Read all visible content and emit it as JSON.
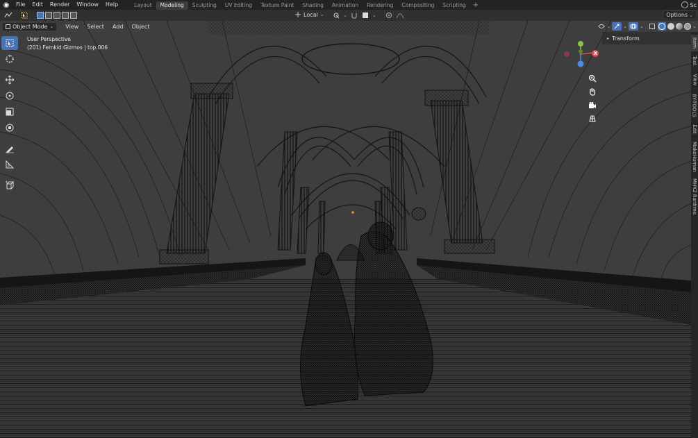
{
  "app": {
    "menus": [
      "File",
      "Edit",
      "Render",
      "Window",
      "Help"
    ],
    "workspaces": [
      "Layout",
      "Modeling",
      "Sculpting",
      "UV Editing",
      "Texture Paint",
      "Shading",
      "Animation",
      "Rendering",
      "Compositing",
      "Scripting"
    ],
    "active_workspace": "Modeling",
    "add_workspace": "+",
    "scene_label": "Sc"
  },
  "toolheader": {
    "orientation_label": "Local",
    "options_label": "Options"
  },
  "viewport": {
    "mode_label": "Object Mode",
    "menus": [
      "View",
      "Select",
      "Add",
      "Object"
    ],
    "perspective_label": "User Perspective",
    "object_info": "(201) Femkid:Gizmos | top.006",
    "gizmo_x_label": "X"
  },
  "npanel": {
    "section_label": "Transform",
    "tabs": [
      "Item",
      "Tool",
      "View",
      "BY-TOOLS",
      "Edit",
      "MakeHuman",
      "MHX2 Runtime"
    ],
    "active_tab": "Item"
  },
  "icons": {
    "tools": [
      "select-box-icon",
      "cursor-icon",
      "move-icon",
      "rotate-icon",
      "scale-icon",
      "transform-icon",
      "annotate-icon",
      "measure-icon",
      "add-cube-icon"
    ],
    "nav": [
      "zoom-icon",
      "pan-hand-icon",
      "camera-icon",
      "grid-icon"
    ]
  },
  "colors": {
    "accent": "#4772b3",
    "axis_x": "#e04b5a",
    "axis_y": "#8ac33f",
    "axis_z": "#4a8de0",
    "wire": "#0e0e0e",
    "background": "#3c3c3c"
  }
}
